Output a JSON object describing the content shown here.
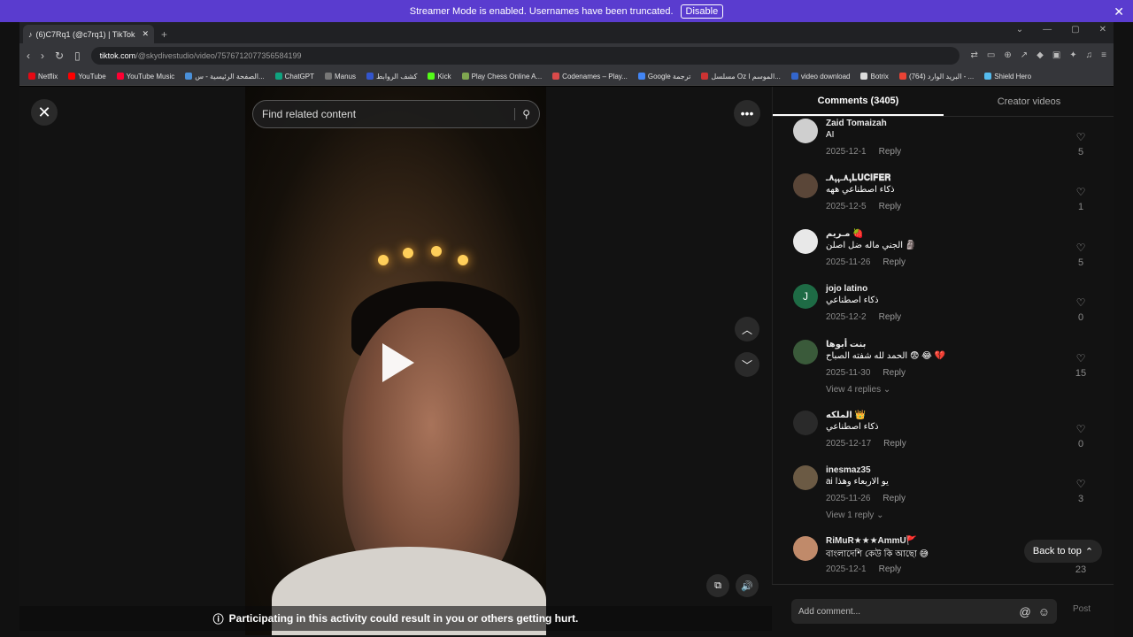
{
  "banner": {
    "text": "Streamer Mode is enabled. Usernames have been truncated.",
    "button": "Disable"
  },
  "browser": {
    "tab_title": "(6)C7Rq1 (@c7rq1) | TikTok",
    "url_host": "tiktok.com",
    "url_path": "/@skydivestudio/video/7576712077356584199",
    "bookmarks": [
      "Netflix",
      "YouTube",
      "YouTube Music",
      "الصفحة الرئيسية - س...",
      "ChatGPT",
      "Manus",
      "كشف الروابط",
      "Kick",
      "Play Chess Online A...",
      "Codenames – Play...",
      "Google ترجمة",
      "مسلسل Oz الموسم ا...",
      "video download",
      "Botrix",
      "البريد الوارد (764) - ...",
      "Shield Hero"
    ],
    "bookmark_colors": [
      "#e50914",
      "#ff0000",
      "#ff0033",
      "#4a90d9",
      "#10a37f",
      "#777777",
      "#3355cc",
      "#53fc18",
      "#7fa650",
      "#d94a4a",
      "#4285f4",
      "#cc3333",
      "#3366cc",
      "#dddddd",
      "#ea4335",
      "#55bbee"
    ]
  },
  "player": {
    "search_placeholder": "Find related content",
    "warning": "Participating in this activity could result in you or others getting hurt."
  },
  "panel": {
    "tab_comments": "Comments (3405)",
    "tab_creator": "Creator videos",
    "reply_label": "Reply",
    "back_to_top": "Back to top",
    "add_placeholder": "Add comment...",
    "post_label": "Post",
    "comments": [
      {
        "name": "Zaid Tomaizah",
        "text": "AI",
        "date": "2025-12-1",
        "likes": "5",
        "avatar_color": "#cfcfcf",
        "initial": ""
      },
      {
        "name": "ﮩ٨ـﮩﮩ٨ـ𝐋𝐔𝐂𝐈𝐅𝐄𝐑",
        "text": "ذكاء اصطناعي ههه",
        "date": "2025-12-5",
        "likes": "1",
        "avatar_color": "#5a4638",
        "initial": ""
      },
      {
        "name": "مـريم 🍓",
        "text": "الجني ماله ضل اصلن 🗿",
        "date": "2025-11-26",
        "likes": "5",
        "avatar_color": "#e8e8e8",
        "initial": ""
      },
      {
        "name": "jojo latino",
        "text": "ذكاء اصطناعي",
        "date": "2025-12-2",
        "likes": "0",
        "avatar_color": "#1e6b45",
        "initial": "J"
      },
      {
        "name": "بنت أبوها",
        "text": "الحمد لله شفته الصباح 😨 😂 💔",
        "date": "2025-11-30",
        "likes": "15",
        "avatar_color": "#3a5a3a",
        "initial": "",
        "replies": "View 4 replies"
      },
      {
        "name": "الملكه 👑",
        "text": "ذكاء اصطناعي",
        "date": "2025-12-17",
        "likes": "0",
        "avatar_color": "#2a2a2a",
        "initial": ""
      },
      {
        "name": "inesmaz35",
        "text": "ai يو الاربعاء وهذا",
        "date": "2025-11-26",
        "likes": "3",
        "avatar_color": "#6b5a44",
        "initial": "",
        "replies": "View 1 reply"
      },
      {
        "name": "RiMuR★★★AmmU🚩",
        "text": "বাংলাদেশি কেউ কি আছো 😅",
        "date": "2025-12-1",
        "likes": "23",
        "avatar_color": "#c08a6a",
        "initial": ""
      }
    ]
  }
}
